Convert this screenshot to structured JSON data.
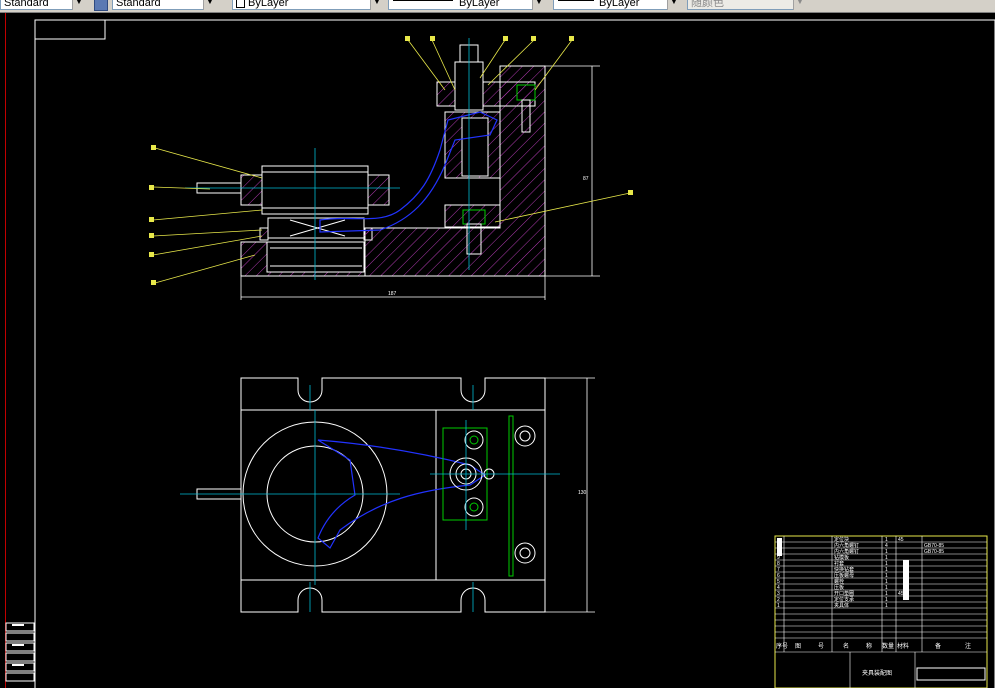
{
  "toolbar": {
    "text_style": "Standard",
    "dim_style": "Standard",
    "layer": "ByLayer",
    "linetype": "ByLayer",
    "lineweight": "ByLayer",
    "plot_style": "随颜色"
  },
  "drawing": {
    "dim_height": "87",
    "dim_width": "187",
    "dim_plan_height": "130",
    "title_block": {
      "header": [
        "序号",
        "图",
        "号",
        "名",
        "称",
        "数量",
        "材料",
        "备",
        "注"
      ],
      "part_name": "夹具装配图",
      "rows": [
        {
          "no": "",
          "name": "定位块",
          "qty": "1",
          "mat": "45",
          "note": ""
        },
        {
          "no": "",
          "name": "内六角螺钉",
          "qty": "4",
          "mat": "",
          "note": "GB70-85"
        },
        {
          "no": "",
          "name": "内六角螺钉",
          "qty": "1",
          "mat": "",
          "note": "GB70-85"
        },
        {
          "no": "9",
          "name": "钻模板",
          "qty": "1",
          "mat": "",
          "note": ""
        },
        {
          "no": "8",
          "name": "衬套",
          "qty": "1",
          "mat": "",
          "note": ""
        },
        {
          "no": "7",
          "name": "快换钻套",
          "qty": "1",
          "mat": "",
          "note": ""
        },
        {
          "no": "6",
          "name": "压板螺母",
          "qty": "1",
          "mat": "",
          "note": ""
        },
        {
          "no": "5",
          "name": "螺栓",
          "qty": "1",
          "mat": "",
          "note": ""
        },
        {
          "no": "4",
          "name": "压板",
          "qty": "1",
          "mat": "",
          "note": ""
        },
        {
          "no": "3",
          "name": "开口垫圈",
          "qty": "1",
          "mat": "45",
          "note": ""
        },
        {
          "no": "2",
          "name": "定位支承",
          "qty": "1",
          "mat": "",
          "note": ""
        },
        {
          "no": "1",
          "name": "夹具体",
          "qty": "1",
          "mat": "",
          "note": ""
        }
      ]
    }
  }
}
